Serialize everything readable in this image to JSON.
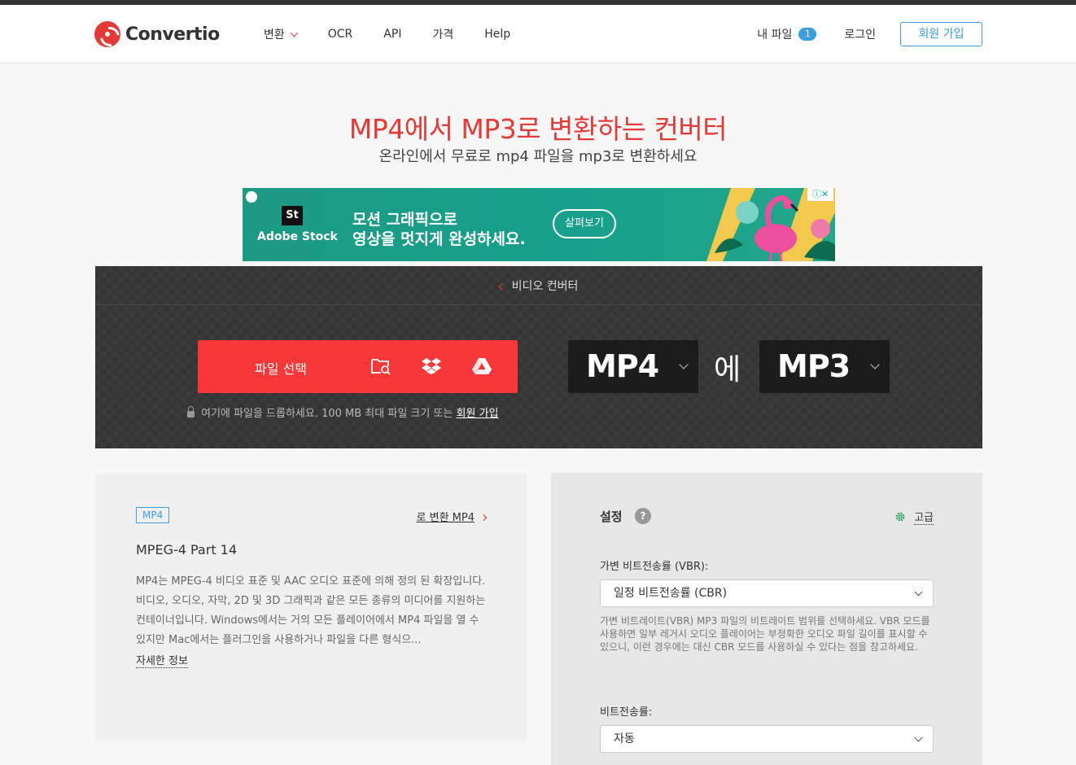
{
  "header": {
    "logo_text": "Convertio",
    "nav": [
      {
        "label": "변환",
        "has_dropdown": true
      },
      {
        "label": "OCR"
      },
      {
        "label": "API"
      },
      {
        "label": "가격"
      },
      {
        "label": "Help"
      }
    ],
    "my_files_label": "내 파일",
    "my_files_count": "1",
    "login_label": "로그인",
    "signup_label": "회원 가입"
  },
  "hero": {
    "title": "MP4에서 MP3로 변환하는 컨버터",
    "subtitle": "온라인에서 무료로 mp4 파일을 mp3로 변환하세요"
  },
  "ad": {
    "badge": "St",
    "brand": "Adobe Stock",
    "line1": "모션 그래픽으로",
    "line2": "영상을 멋지게 완성하세요.",
    "cta": "살펴보기"
  },
  "converter": {
    "back_label": "비디오 컨버터",
    "choose_label": "파일 선택",
    "drop_note": "여기에 파일을 드롭하세요. 100 MB 최대 파일 크기 또는",
    "drop_signup": "회원 가입",
    "from_format": "MP4",
    "to_word": "에",
    "to_format": "MP3"
  },
  "format_card": {
    "tag": "MP4",
    "convert_link": "로 변환 MP4",
    "full_name": "MPEG-4 Part 14",
    "description": "MP4는 MPEG-4 비디오 표준 및 AAC 오디오 표준에 의해 정의 된 확장입니다. 비디오, 오디오, 자막, 2D 및 3D 그래픽과 같은 모든 종류의 미디어를 지원하는 컨테이너입니다. Windows에서는 거의 모든 플레이어에서 MP4 파일을 열 수 있지만 Mac에서는 플러그인을 사용하거나 파일을 다른 형식으...",
    "more_info": "자세한 정보"
  },
  "settings": {
    "title": "설정",
    "help_icon": "?",
    "advanced_label": "고급",
    "vbr_label": "가변 비트전송률 (VBR):",
    "vbr_value": "일정 비트전송률 (CBR)",
    "vbr_help": "가변 비트레이트(VBR) MP3 파일의 비트레이트 범위를 선택하세요. VBR 모드를 사용하면 일부 레거시 오디오 플레이어는 부정확한 오디오 파일 길이를 표시할 수 있으니, 이런 경우에는 대신 CBR 모드를 사용하실 수 있다는 점을 참고하세요.",
    "bitrate_label": "비트전송률:",
    "bitrate_value": "자동"
  },
  "colors": {
    "brand_red": "#e53935",
    "accent_blue": "#3a9ee0",
    "button_red": "#f83838"
  }
}
